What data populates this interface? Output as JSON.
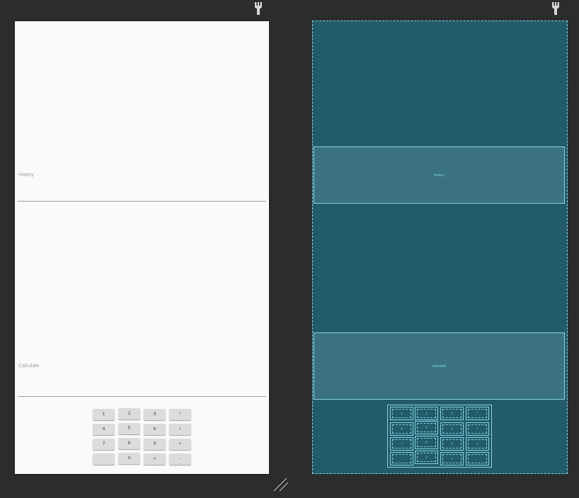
{
  "design": {
    "history_hint": "History",
    "calculate_hint": "Calculate",
    "keys": [
      "1",
      "2",
      "3",
      "*",
      "4",
      "5",
      "6",
      "/",
      "7",
      "8",
      "9",
      "+",
      ".",
      "0",
      "=",
      "-"
    ]
  },
  "blueprint": {
    "history_label": "history",
    "calculate_label": "calculate",
    "keys": [
      "1",
      "2",
      "3",
      "*",
      "4",
      "5",
      "6",
      "/",
      "7",
      "8",
      "9",
      "+",
      ".",
      "0",
      "=",
      "-"
    ]
  },
  "icons": {
    "orientation": "wrench-icon",
    "resize": "resize-handle-icon"
  },
  "colors": {
    "canvas": "#2b2c2e",
    "design_surface": "#fafafa",
    "blueprint_surface": "#225b6a",
    "blueprint_outline": "#7fd7e4"
  }
}
